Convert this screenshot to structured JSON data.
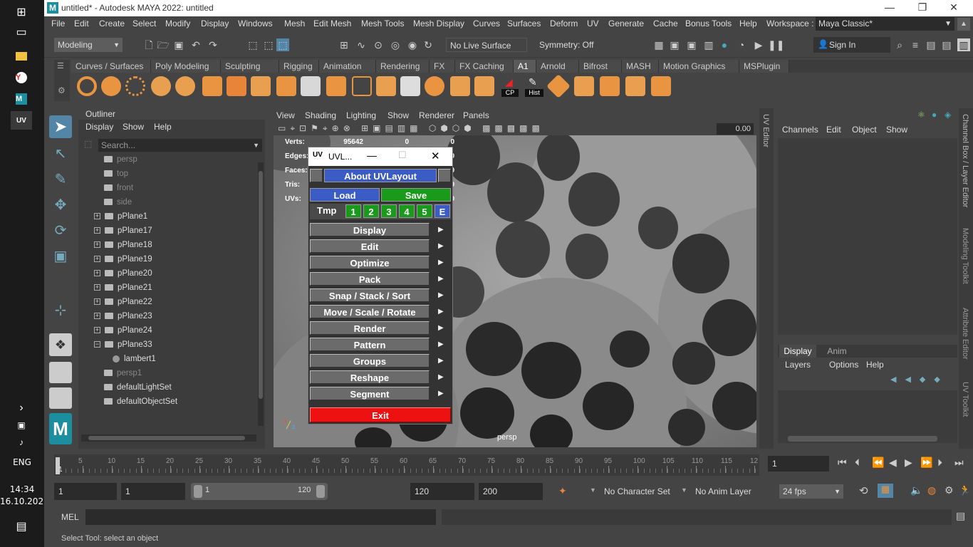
{
  "window": {
    "title": "untitled* - Autodesk MAYA 2022: untitled",
    "logo": "M"
  },
  "taskbar": {
    "lang": "ENG",
    "time": "14:34",
    "date": "16.10.2021"
  },
  "menubar": {
    "items": [
      "File",
      "Edit",
      "Create",
      "Select",
      "Modify",
      "Display",
      "Windows",
      "Mesh",
      "Edit Mesh",
      "Mesh Tools",
      "Mesh Display",
      "Curves",
      "Surfaces",
      "Deform",
      "UV",
      "Generate",
      "Cache",
      "Bonus Tools",
      "Help"
    ],
    "workspace_label": "Workspace :",
    "workspace_value": "Maya Classic*"
  },
  "statusline": {
    "mode": "Modeling",
    "live_surface": "No Live Surface",
    "symmetry": "Symmetry: Off",
    "sign_in": "Sign In"
  },
  "shelf": {
    "tabs": [
      "Curves / Surfaces",
      "Poly Modeling",
      "Sculpting",
      "Rigging",
      "Animation",
      "Rendering",
      "FX",
      "FX Caching",
      "A1",
      "Arnold",
      "Bifrost",
      "MASH",
      "Motion Graphics",
      "MSPlugin"
    ],
    "active_tab": "A1",
    "cp_label": "CP",
    "hist_label": "Hist"
  },
  "outliner": {
    "title": "Outliner",
    "menu": [
      "Display",
      "Show",
      "Help"
    ],
    "search_placeholder": "Search...",
    "items": [
      {
        "label": "persp",
        "dim": true,
        "expand": false,
        "indent": 0
      },
      {
        "label": "top",
        "dim": true,
        "expand": false,
        "indent": 0
      },
      {
        "label": "front",
        "dim": true,
        "expand": false,
        "indent": 0
      },
      {
        "label": "side",
        "dim": true,
        "expand": false,
        "indent": 0
      },
      {
        "label": "pPlane1",
        "dim": false,
        "expand": true,
        "indent": 0
      },
      {
        "label": "pPlane17",
        "dim": false,
        "expand": true,
        "indent": 0
      },
      {
        "label": "pPlane18",
        "dim": false,
        "expand": true,
        "indent": 0
      },
      {
        "label": "pPlane19",
        "dim": false,
        "expand": true,
        "indent": 0
      },
      {
        "label": "pPlane20",
        "dim": false,
        "expand": true,
        "indent": 0
      },
      {
        "label": "pPlane21",
        "dim": false,
        "expand": true,
        "indent": 0
      },
      {
        "label": "pPlane22",
        "dim": false,
        "expand": true,
        "indent": 0
      },
      {
        "label": "pPlane23",
        "dim": false,
        "expand": true,
        "indent": 0
      },
      {
        "label": "pPlane24",
        "dim": false,
        "expand": true,
        "indent": 0
      },
      {
        "label": "pPlane33",
        "dim": false,
        "expand": true,
        "indent": 0
      },
      {
        "label": "lambert1",
        "dim": false,
        "expand": false,
        "indent": 1
      },
      {
        "label": "persp1",
        "dim": true,
        "expand": false,
        "indent": 0
      },
      {
        "label": "defaultLightSet",
        "dim": false,
        "expand": false,
        "indent": 0
      },
      {
        "label": "defaultObjectSet",
        "dim": false,
        "expand": false,
        "indent": 0
      }
    ]
  },
  "viewport": {
    "menu": [
      "View",
      "Shading",
      "Lighting",
      "Show",
      "Renderer",
      "Panels"
    ],
    "exposure": "0.00",
    "camera_label": "persp",
    "hud": [
      {
        "label": "Verts:",
        "v1": "95642",
        "v2": "0",
        "v3": "0"
      },
      {
        "label": "Edges:",
        "v1": "",
        "v2": "",
        "v3": "0"
      },
      {
        "label": "Faces:",
        "v1": "",
        "v2": "",
        "v3": "0"
      },
      {
        "label": "Tris:",
        "v1": "",
        "v2": "",
        "v3": "0"
      },
      {
        "label": "UVs:",
        "v1": "",
        "v2": "",
        "v3": "0"
      }
    ]
  },
  "uvlayout": {
    "title": "UVL...",
    "about": "About UVLayout",
    "load": "Load",
    "save": "Save",
    "tmp_label": "Tmp",
    "slots": [
      "1",
      "2",
      "3",
      "4",
      "5",
      "E"
    ],
    "menu": [
      "Display",
      "Edit",
      "Optimize",
      "Pack",
      "Snap / Stack / Sort",
      "Move / Scale / Rotate",
      "Render",
      "Pattern",
      "Groups",
      "Reshape",
      "Segment"
    ],
    "exit": "Exit"
  },
  "channelbox": {
    "menu": [
      "Channels",
      "Edit",
      "Object",
      "Show"
    ],
    "layer_tabs": [
      "Display",
      "Anim"
    ],
    "layer_menu": [
      "Layers",
      "Options",
      "Help"
    ]
  },
  "side_tabs": {
    "uv_editor": "UV Editor",
    "channel_box": "Channel Box / Layer Editor",
    "modeling_toolkit": "Modeling Toolkit",
    "attribute_editor": "Attribute Editor",
    "uv_toolkit": "UV Toolkit"
  },
  "timeslider": {
    "ticks": [
      "5",
      "10",
      "15",
      "20",
      "25",
      "30",
      "35",
      "40",
      "45",
      "50",
      "55",
      "60",
      "65",
      "70",
      "75",
      "80",
      "85",
      "90",
      "95",
      "100",
      "105",
      "110",
      "115",
      "12"
    ],
    "current_frame": "1"
  },
  "rangeslider": {
    "start": "1",
    "playback_start": "1",
    "range_start": "1",
    "range_end": "120",
    "playback_end": "120",
    "end": "200",
    "character_set": "No Character Set",
    "anim_layer": "No Anim Layer",
    "fps": "24 fps"
  },
  "cmdline": {
    "label": "MEL"
  },
  "helpline": {
    "text": "Select Tool: select an object"
  }
}
